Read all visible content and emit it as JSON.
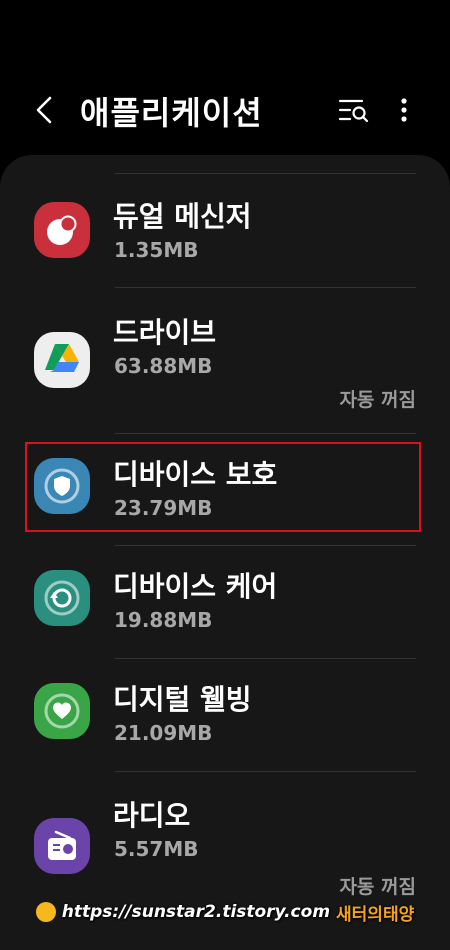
{
  "header": {
    "title": "애플리케이션"
  },
  "apps": [
    {
      "name": "듀얼 메신저",
      "size": "1.35MB",
      "icon": "dual-messenger-icon",
      "color": "#c9303b"
    },
    {
      "name": "드라이브",
      "size": "63.88MB",
      "status": "자동 꺼짐",
      "icon": "google-drive-icon",
      "color": "#eeeeee"
    },
    {
      "name": "디바이스 보호",
      "size": "23.79MB",
      "icon": "device-protection-shield-icon",
      "color": "#3a87b6"
    },
    {
      "name": "디바이스 케어",
      "size": "19.88MB",
      "icon": "device-care-icon",
      "color": "#2a8f7f"
    },
    {
      "name": "디지털 웰빙",
      "size": "21.09MB",
      "icon": "digital-wellbeing-heart-icon",
      "color": "#3aa546"
    },
    {
      "name": "라디오",
      "size": "5.57MB",
      "status": "자동 꺼짐",
      "icon": "radio-icon",
      "color": "#6a44a8"
    }
  ],
  "watermark": {
    "url": "https://sunstar2.tistory.com",
    "brand": "새터의태양"
  },
  "colors": {
    "highlight": "#d8121d",
    "background": "#000000",
    "panel": "#171717"
  }
}
